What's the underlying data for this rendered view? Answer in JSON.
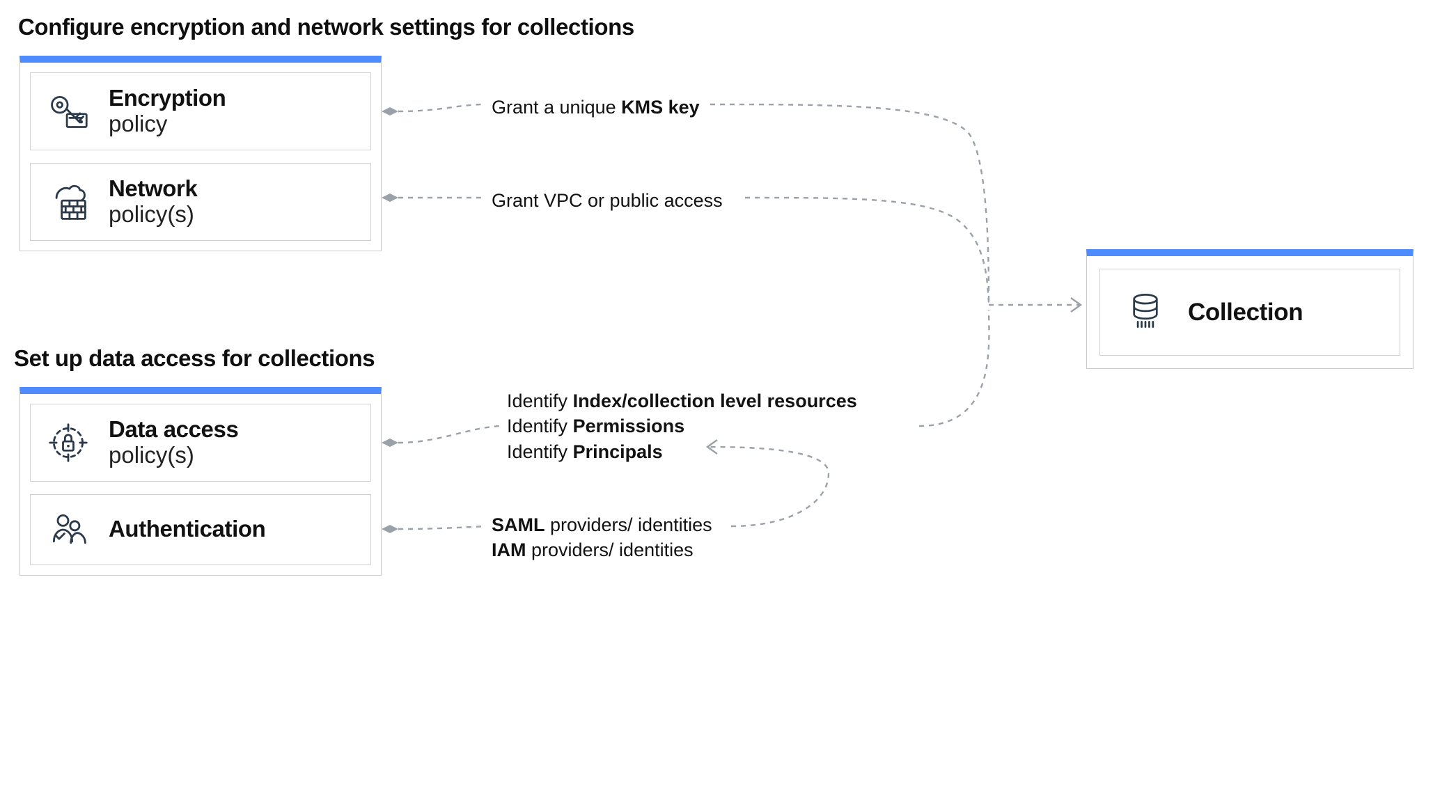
{
  "sections": {
    "configure": {
      "title": "Configure encryption and network settings for collections"
    },
    "access": {
      "title": "Set up data access for collections"
    }
  },
  "panels": {
    "configure": {
      "items": [
        {
          "icon": "key-icon",
          "title": "Encryption",
          "sub": "policy"
        },
        {
          "icon": "firewall-icon",
          "title": "Network",
          "sub": "policy(s)"
        }
      ]
    },
    "access": {
      "items": [
        {
          "icon": "lock-target-icon",
          "title": "Data access",
          "sub": "policy(s)"
        },
        {
          "icon": "users-icon",
          "title": "Authentication",
          "sub": ""
        }
      ]
    }
  },
  "collection": {
    "title": "Collection"
  },
  "edges": {
    "kms": {
      "prefix": "Grant a unique ",
      "bold": "KMS key"
    },
    "vpc": {
      "text": "Grant VPC or public access"
    },
    "identify": {
      "line1_prefix": "Identify ",
      "line1_bold": "Index/collection level resources",
      "line2_prefix": "Identify ",
      "line2_bold": "Permissions",
      "line3_prefix": "Identify ",
      "line3_bold": "Principals"
    },
    "auth": {
      "line1_bold": "SAML",
      "line1_rest": " providers/ identities",
      "line2_bold": "IAM",
      "line2_rest": " providers/ identities"
    }
  }
}
